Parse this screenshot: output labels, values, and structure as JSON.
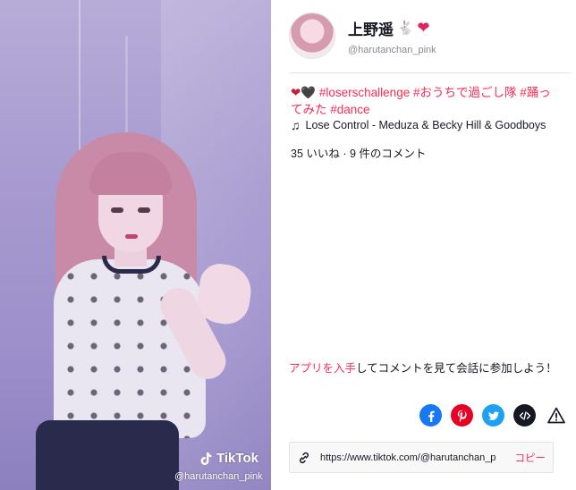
{
  "video": {
    "watermark_brand": "TikTok",
    "watermark_user": "@harutanchan_pink"
  },
  "author": {
    "display_name": "上野遥",
    "display_emoji": "🐇",
    "display_heart": "❤",
    "username": "@harutanchan_pink"
  },
  "description": {
    "emoji_red": "❤",
    "emoji_black": "🖤",
    "tags": [
      "#loserschallenge",
      "#おうちで過ごし隊",
      "#踊ってみた",
      "#dance"
    ]
  },
  "music": {
    "icon": "music-note-icon",
    "title": "Lose Control - Meduza & Becky Hill & Goodboys"
  },
  "stats": {
    "text": "35 いいね · 9 件のコメント"
  },
  "cta": {
    "link": "アプリを入手",
    "rest": "してコメントを見て会話に参加しよう！"
  },
  "share": {
    "icons": [
      "facebook-icon",
      "pinterest-icon",
      "twitter-icon",
      "embed-icon",
      "report-icon"
    ]
  },
  "copy": {
    "url": "https://www.tiktok.com/@harutanchan_p",
    "button": "コピー"
  },
  "colors": {
    "accent": "#fe2c55",
    "facebook": "#1877f2",
    "pinterest": "#e60023",
    "twitter": "#1da1f2"
  }
}
